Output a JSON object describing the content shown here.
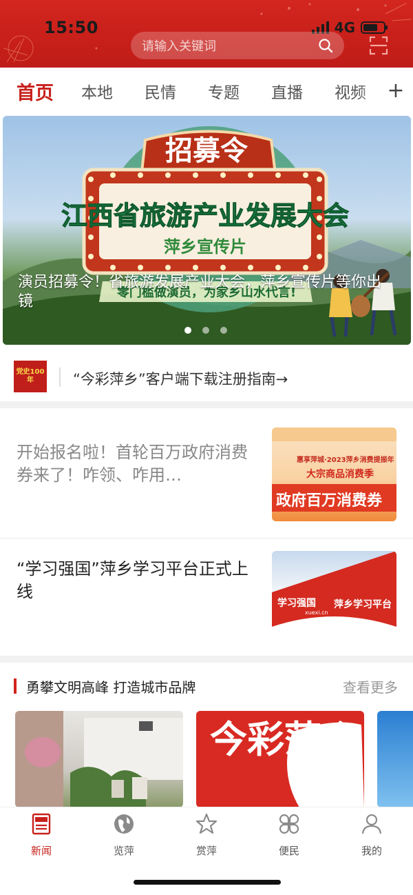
{
  "status": {
    "time": "15:50",
    "network": "4G"
  },
  "search": {
    "placeholder": "请输入关键词"
  },
  "tabs": [
    {
      "label": "首页",
      "active": true
    },
    {
      "label": "本地"
    },
    {
      "label": "民情"
    },
    {
      "label": "专题"
    },
    {
      "label": "直播"
    },
    {
      "label": "视频"
    }
  ],
  "banner": {
    "caption": "演员招募令！省旅游发展产业大会，萍乡宣传片等你出镜",
    "sign_top": "招募令",
    "sign_main": "江西省旅游产业发展大会",
    "sign_sub": "萍乡宣传片",
    "slogan": "零门槛做演员，为家乡山水代言!",
    "slides": 3,
    "active_slide": 1
  },
  "guide": {
    "logo_text": "党史100年",
    "text": "“今彩萍乡”客户端下载注册指南→"
  },
  "news": [
    {
      "title": "开始报名啦！首轮百万政府消费券来了！咋领、咋用…",
      "thumb_line1": "惠享萍城·2023萍乡消费提振年",
      "thumb_line2": "大宗商品消费季",
      "thumb_line3": "政府百万消费券",
      "color": "#888888"
    },
    {
      "title": "“学习强国”萍乡学习平台正式上线",
      "thumb_logo": "学习强国",
      "thumb_logo_sub": "xuexi.cn",
      "thumb_text": "萍乡学习平台",
      "color": "#222222"
    }
  ],
  "section": {
    "title": "勇攀文明高峰  打造城市品牌",
    "more": "查看更多"
  },
  "cards": [
    {
      "text": ""
    },
    {
      "text": "今彩萍乡"
    }
  ],
  "bottom_nav": [
    {
      "label": "新闻",
      "icon": "news-icon",
      "active": true
    },
    {
      "label": "览萍",
      "icon": "globe-icon"
    },
    {
      "label": "赏萍",
      "icon": "star-icon"
    },
    {
      "label": "便民",
      "icon": "grid-icon"
    },
    {
      "label": "我的",
      "icon": "user-icon"
    }
  ],
  "colors": {
    "brand_red": "#c8201b"
  }
}
